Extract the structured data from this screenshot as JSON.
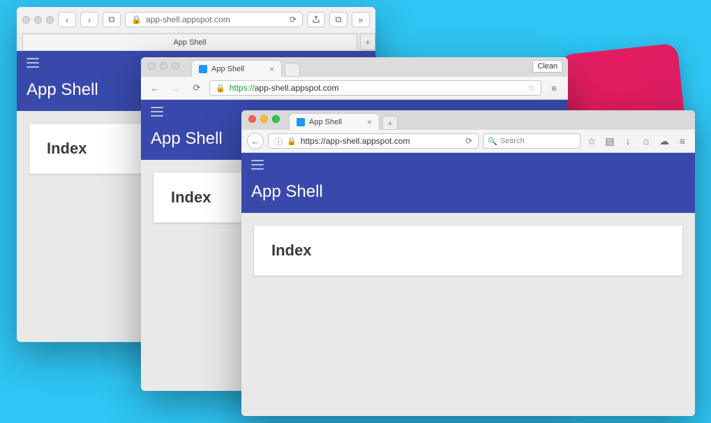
{
  "safari": {
    "url_display": "app-shell.appspot.com",
    "tab_title": "App Shell",
    "app_title": "App Shell",
    "card_title": "Index"
  },
  "chrome": {
    "tab_title": "App Shell",
    "url_prefix": "https://",
    "url_host": "app-shell.appspot.com",
    "clean_label": "Clean",
    "app_title": "App Shell",
    "card_title": "Index"
  },
  "firefox": {
    "tab_title": "App Shell",
    "url": "https://app-shell.appspot.com",
    "search_placeholder": "Search",
    "app_title": "App Shell",
    "card_title": "Index"
  }
}
